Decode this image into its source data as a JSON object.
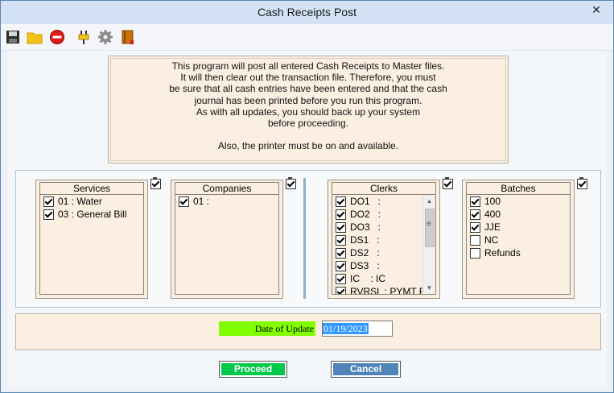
{
  "window": {
    "title": "Cash Receipts Post",
    "close_glyph": "✕"
  },
  "toolbar": {
    "icons": [
      "save-icon",
      "open-folder-icon",
      "stop-icon",
      "plug-icon",
      "gear-icon",
      "book-icon"
    ]
  },
  "notice": {
    "lines": [
      "This program will post all entered Cash Receipts to Master files.",
      "It will then clear out the transaction file. Therefore, you must",
      "be sure that all cash entries have been entered and that the cash",
      "journal has been printed before you run this program.",
      "As with all updates, you should back up your system",
      "before proceeding.",
      "",
      "Also, the printer must be on and available."
    ]
  },
  "services": {
    "title": "Services",
    "items": [
      {
        "label": "01 : Water",
        "checked": true
      },
      {
        "label": "03 : General Bill",
        "checked": true
      }
    ]
  },
  "companies": {
    "title": "Companies",
    "items": [
      {
        "label": "01 :",
        "checked": true
      }
    ]
  },
  "clerks": {
    "title": "Clerks",
    "items": [
      {
        "label": "DO1   :",
        "checked": true
      },
      {
        "label": "DO2   :",
        "checked": true
      },
      {
        "label": "DO3   :",
        "checked": true
      },
      {
        "label": "DS1   :",
        "checked": true
      },
      {
        "label": "DS2   :",
        "checked": true
      },
      {
        "label": "DS3   :",
        "checked": true
      },
      {
        "label": "IC    : IC",
        "checked": true
      },
      {
        "label": "RVRSL : PYMT R",
        "checked": true
      }
    ]
  },
  "batches": {
    "title": "Batches",
    "items": [
      {
        "label": "100",
        "checked": true
      },
      {
        "label": "400",
        "checked": true
      },
      {
        "label": "JJE",
        "checked": true
      },
      {
        "label": "NC",
        "checked": false
      },
      {
        "label": "Refunds",
        "checked": false
      }
    ]
  },
  "date": {
    "label": "Date of Update",
    "value": "01/19/2023"
  },
  "buttons": {
    "proceed": "Proceed",
    "cancel": "Cancel"
  },
  "colors": {
    "accent_green": "#80ff00",
    "proceed_green": "#00c94a",
    "cancel_blue": "#4f84b8",
    "panel_beige": "#fbefe2",
    "titlebar": "#d3e3f5"
  }
}
